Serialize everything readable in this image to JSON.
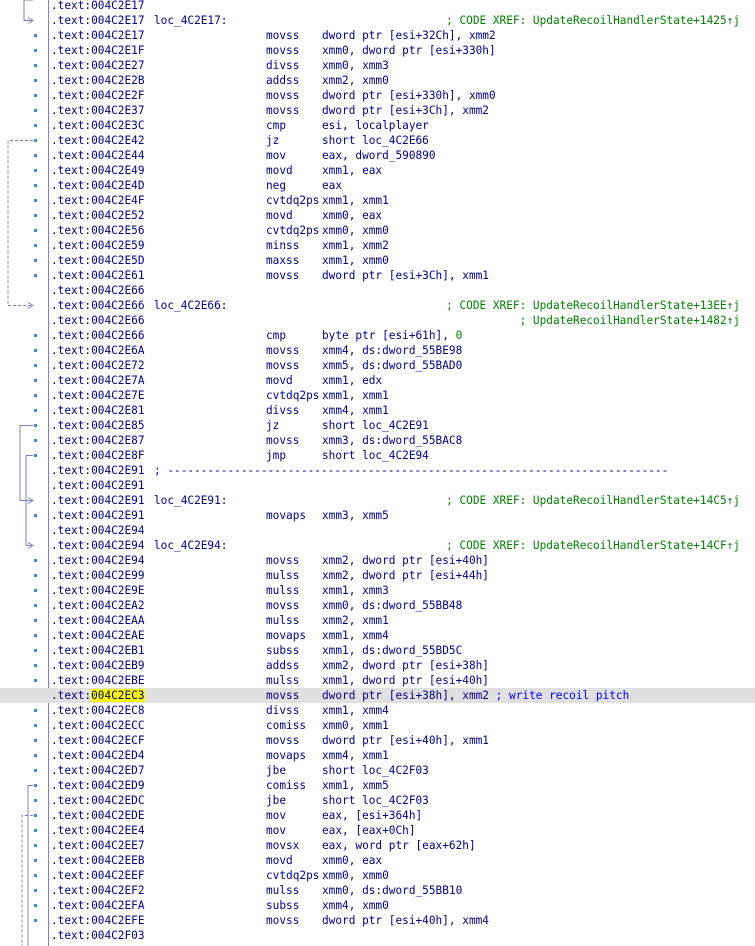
{
  "segment": ".text",
  "highlighted_address": "004C2EC3",
  "lines": [
    {
      "addr": "004C2E17"
    },
    {
      "addr": "004C2E17",
      "label": "loc_4C2E17:",
      "comment": "; CODE XREF: UpdateRecoilHandlerState+1425↑j"
    },
    {
      "addr": "004C2E17",
      "mnem": "movss",
      "ops": "dword ptr [esi+32Ch], xmm2"
    },
    {
      "addr": "004C2E1F",
      "mnem": "movss",
      "ops": "xmm0, dword ptr [esi+330h]"
    },
    {
      "addr": "004C2E27",
      "mnem": "divss",
      "ops": "xmm0, xmm3"
    },
    {
      "addr": "004C2E2B",
      "mnem": "addss",
      "ops": "xmm2, xmm0"
    },
    {
      "addr": "004C2E2F",
      "mnem": "movss",
      "ops": "dword ptr [esi+330h], xmm0"
    },
    {
      "addr": "004C2E37",
      "mnem": "movss",
      "ops": "dword ptr [esi+3Ch], xmm2"
    },
    {
      "addr": "004C2E3C",
      "mnem": "cmp",
      "ops": "esi, localplayer"
    },
    {
      "addr": "004C2E42",
      "mnem": "jz",
      "ops": "short loc_4C2E66"
    },
    {
      "addr": "004C2E44",
      "mnem": "mov",
      "ops": "eax, dword_590890"
    },
    {
      "addr": "004C2E49",
      "mnem": "movd",
      "ops": "xmm1, eax"
    },
    {
      "addr": "004C2E4D",
      "mnem": "neg",
      "ops": "eax"
    },
    {
      "addr": "004C2E4F",
      "mnem": "cvtdq2ps",
      "ops": "xmm1, xmm1"
    },
    {
      "addr": "004C2E52",
      "mnem": "movd",
      "ops": "xmm0, eax"
    },
    {
      "addr": "004C2E56",
      "mnem": "cvtdq2ps",
      "ops": "xmm0, xmm0"
    },
    {
      "addr": "004C2E59",
      "mnem": "minss",
      "ops": "xmm1, xmm2"
    },
    {
      "addr": "004C2E5D",
      "mnem": "maxss",
      "ops": "xmm1, xmm0"
    },
    {
      "addr": "004C2E61",
      "mnem": "movss",
      "ops": "dword ptr [esi+3Ch], xmm1"
    },
    {
      "addr": "004C2E66"
    },
    {
      "addr": "004C2E66",
      "label": "loc_4C2E66:",
      "comment": "; CODE XREF: UpdateRecoilHandlerState+13EE↑j"
    },
    {
      "addr": "004C2E66",
      "comment": "; UpdateRecoilHandlerState+1482↑j"
    },
    {
      "addr": "004C2E66",
      "mnem": "cmp",
      "ops": "byte ptr [esi+61h], 0"
    },
    {
      "addr": "004C2E6A",
      "mnem": "movss",
      "ops": "xmm4, ds:dword_55BE98"
    },
    {
      "addr": "004C2E72",
      "mnem": "movss",
      "ops": "xmm5, ds:dword_55BAD0"
    },
    {
      "addr": "004C2E7A",
      "mnem": "movd",
      "ops": "xmm1, edx"
    },
    {
      "addr": "004C2E7E",
      "mnem": "cvtdq2ps",
      "ops": "xmm1, xmm1"
    },
    {
      "addr": "004C2E81",
      "mnem": "divss",
      "ops": "xmm4, xmm1"
    },
    {
      "addr": "004C2E85",
      "mnem": "jz",
      "ops": "short loc_4C2E91"
    },
    {
      "addr": "004C2E87",
      "mnem": "movss",
      "ops": "xmm3, ds:dword_55BAC8"
    },
    {
      "addr": "004C2E8F",
      "mnem": "jmp",
      "ops": "short loc_4C2E94"
    },
    {
      "addr": "004C2E91",
      "separator": "; ---------------------------------------------------------------------------"
    },
    {
      "addr": "004C2E91"
    },
    {
      "addr": "004C2E91",
      "label": "loc_4C2E91:",
      "comment": "; CODE XREF: UpdateRecoilHandlerState+14C5↑j"
    },
    {
      "addr": "004C2E91",
      "mnem": "movaps",
      "ops": "xmm3, xmm5"
    },
    {
      "addr": "004C2E94"
    },
    {
      "addr": "004C2E94",
      "label": "loc_4C2E94:",
      "comment": "; CODE XREF: UpdateRecoilHandlerState+14CF↑j"
    },
    {
      "addr": "004C2E94",
      "mnem": "movss",
      "ops": "xmm2, dword ptr [esi+40h]"
    },
    {
      "addr": "004C2E99",
      "mnem": "mulss",
      "ops": "xmm2, dword ptr [esi+44h]"
    },
    {
      "addr": "004C2E9E",
      "mnem": "mulss",
      "ops": "xmm1, xmm3"
    },
    {
      "addr": "004C2EA2",
      "mnem": "movss",
      "ops": "xmm0, ds:dword_55BB48"
    },
    {
      "addr": "004C2EAA",
      "mnem": "mulss",
      "ops": "xmm2, xmm1"
    },
    {
      "addr": "004C2EAE",
      "mnem": "movaps",
      "ops": "xmm1, xmm4"
    },
    {
      "addr": "004C2EB1",
      "mnem": "subss",
      "ops": "xmm1, ds:dword_55BD5C"
    },
    {
      "addr": "004C2EB9",
      "mnem": "addss",
      "ops": "xmm2, dword ptr [esi+38h]"
    },
    {
      "addr": "004C2EBE",
      "mnem": "mulss",
      "ops": "xmm1, dword ptr [esi+40h]"
    },
    {
      "addr": "004C2EC3",
      "mnem": "movss",
      "ops": "dword ptr [esi+38h], xmm2",
      "inline_comment": "; write recoil pitch",
      "highlight": true
    },
    {
      "addr": "004C2EC8",
      "mnem": "divss",
      "ops": "xmm1, xmm4"
    },
    {
      "addr": "004C2ECC",
      "mnem": "comiss",
      "ops": "xmm0, xmm1"
    },
    {
      "addr": "004C2ECF",
      "mnem": "movss",
      "ops": "dword ptr [esi+40h], xmm1"
    },
    {
      "addr": "004C2ED4",
      "mnem": "movaps",
      "ops": "xmm4, xmm1"
    },
    {
      "addr": "004C2ED7",
      "mnem": "jbe",
      "ops": "short loc_4C2F03"
    },
    {
      "addr": "004C2ED9",
      "mnem": "comiss",
      "ops": "xmm1, xmm5"
    },
    {
      "addr": "004C2EDC",
      "mnem": "jbe",
      "ops": "short loc_4C2F03"
    },
    {
      "addr": "004C2EDE",
      "mnem": "mov",
      "ops": "eax, [esi+364h]"
    },
    {
      "addr": "004C2EE4",
      "mnem": "mov",
      "ops": "eax, [eax+0Ch]"
    },
    {
      "addr": "004C2EE7",
      "mnem": "movsx",
      "ops": "eax, word ptr [eax+62h]"
    },
    {
      "addr": "004C2EEB",
      "mnem": "movd",
      "ops": "xmm0, eax"
    },
    {
      "addr": "004C2EEF",
      "mnem": "cvtdq2ps",
      "ops": "xmm0, xmm0"
    },
    {
      "addr": "004C2EF2",
      "mnem": "mulss",
      "ops": "xmm0, ds:dword_55BB10"
    },
    {
      "addr": "004C2EFA",
      "mnem": "subss",
      "ops": "xmm4, xmm0"
    },
    {
      "addr": "004C2EFE",
      "mnem": "movss",
      "ops": "dword ptr [esi+40h], xmm4"
    },
    {
      "addr": "004C2F03"
    }
  ],
  "colors": {
    "text": "#000080",
    "comment": "#008000",
    "inline_comment": "#0000ff",
    "highlight_row": "#e0e0e0",
    "highlight_addr": "#ffff00",
    "arrow": "#8080c0"
  }
}
